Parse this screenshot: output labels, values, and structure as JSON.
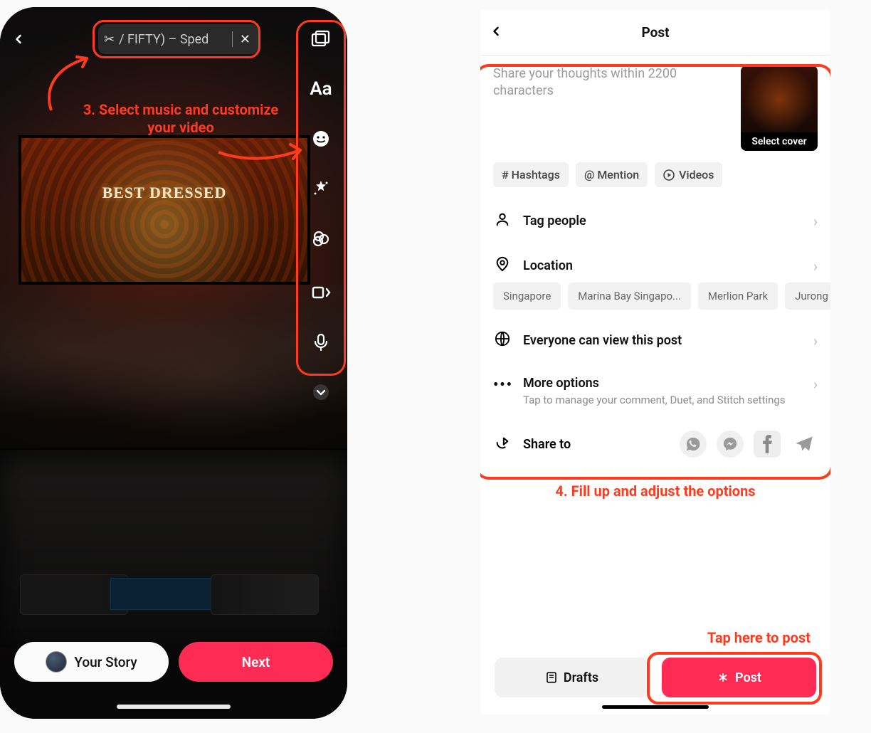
{
  "left": {
    "music_chip_text": "/ FIFTY) – Sped",
    "stage_text": "BEST DRESSED",
    "your_story": "Your Story",
    "next": "Next"
  },
  "annotations": {
    "step3": "3. Select music and customize your video",
    "step4": "4. Fill up and adjust the options",
    "tap_post": "Tap here to post"
  },
  "right": {
    "header_title": "Post",
    "caption_placeholder": "Share your thoughts within 2200 characters",
    "cover_label": "Select cover",
    "chips": {
      "hashtags": "# Hashtags",
      "mention": "@ Mention",
      "videos": "Videos"
    },
    "rows": {
      "tag_people": "Tag people",
      "location": "Location",
      "visibility": "Everyone can view this post",
      "more_options": "More options",
      "more_options_sub": "Tap to manage your comment, Duet, and Stitch settings",
      "share_to": "Share to"
    },
    "locations": {
      "l1": "Singapore",
      "l2": "Marina Bay Singapo...",
      "l3": "Merlion Park",
      "l4": "Jurong Isla"
    },
    "drafts": "Drafts",
    "post": "Post"
  }
}
